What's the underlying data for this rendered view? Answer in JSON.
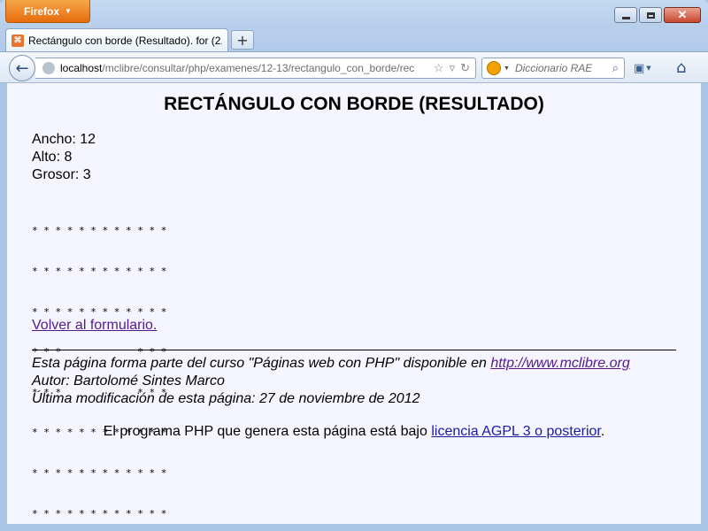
{
  "browser": {
    "menu_button": "Firefox",
    "tab_title": "Rectángulo con borde (Resultado). for (2...",
    "url_host": "localhost",
    "url_path": "/mclibre/consultar/php/examenes/12-13/rectangulo_con_borde/rec",
    "search_placeholder": "Diccionario RAE"
  },
  "page": {
    "title": "RECTÁNGULO CON BORDE (RESULTADO)",
    "params": [
      "Ancho: 12",
      "Alto: 8",
      "Grosor: 3"
    ],
    "grid_rows": [
      "* * * * * * * * * * * *",
      "* * * * * * * * * * * *",
      "* * * * * * * * * * * *",
      "* * *             * * *",
      "* * *             * * *",
      "* * * * * * * * * * * *",
      "* * * * * * * * * * * *",
      "* * * * * * * * * * * *"
    ],
    "back_link": "Volver al formulario.",
    "footer_lines": {
      "line1_text": "Esta página forma parte del curso \"Páginas web con PHP\" disponible en ",
      "line1_link": "http://www.mclibre.org",
      "line2": "Autor: Bartolomé Sintes Marco",
      "line3": "Última modificación de esta página: 27 de noviembre de 2012"
    },
    "license_text": "El programa PHP que genera esta página está bajo ",
    "license_link": "licencia AGPL 3 o posterior",
    "license_end": "."
  }
}
